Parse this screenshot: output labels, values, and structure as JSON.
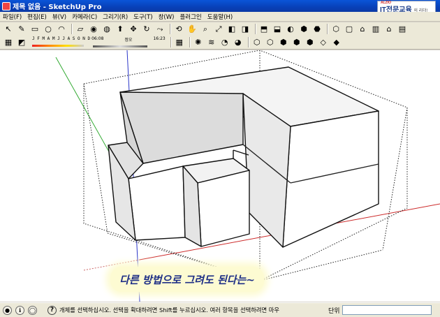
{
  "window": {
    "title": "제목 없음 - SketchUp Pro"
  },
  "brand": {
    "small": "ALZIO",
    "main": "IT전문교육",
    "tail": "의 리더!"
  },
  "menu": [
    "파일(F)",
    "편집(E)",
    "뷰(V)",
    "카메라(C)",
    "그리기(R)",
    "도구(T)",
    "창(W)",
    "플러그인",
    "도움말(H)"
  ],
  "toolbar1": [
    {
      "name": "select-icon",
      "glyph": "↖"
    },
    {
      "name": "pencil-icon",
      "glyph": "✎"
    },
    {
      "name": "rectangle-icon",
      "glyph": "▭"
    },
    {
      "name": "circle-icon",
      "glyph": "○"
    },
    {
      "name": "arc-icon",
      "glyph": "◠"
    },
    {
      "name": "eraser-icon",
      "glyph": "▱"
    },
    {
      "name": "tape-measure-icon",
      "glyph": "◉"
    },
    {
      "name": "paint-bucket-icon",
      "glyph": "◍"
    },
    {
      "name": "push-pull-icon",
      "glyph": "⬆"
    },
    {
      "name": "move-icon",
      "glyph": "✥"
    },
    {
      "name": "rotate-icon",
      "glyph": "↻"
    },
    {
      "name": "follow-me-icon",
      "glyph": "⤳"
    },
    {
      "name": "orbit-icon",
      "glyph": "⟲"
    },
    {
      "name": "pan-icon",
      "glyph": "✋"
    },
    {
      "name": "zoom-icon",
      "glyph": "⌕"
    },
    {
      "name": "zoom-extents-icon",
      "glyph": "⤢"
    },
    {
      "name": "previous-view-icon",
      "glyph": "◧"
    },
    {
      "name": "next-view-icon",
      "glyph": "◨"
    },
    {
      "name": "get-models-icon",
      "glyph": "⬒"
    },
    {
      "name": "share-model-icon",
      "glyph": "⬓"
    },
    {
      "name": "google-earth-icon",
      "glyph": "◐"
    },
    {
      "name": "components-icon",
      "glyph": "⬢"
    },
    {
      "name": "materials-icon",
      "glyph": "⬣"
    },
    {
      "name": "iso-view-icon",
      "glyph": "⬡"
    },
    {
      "name": "top-view-icon",
      "glyph": "▢"
    },
    {
      "name": "front-view-icon",
      "glyph": "⌂"
    },
    {
      "name": "right-view-icon",
      "glyph": "▥"
    },
    {
      "name": "back-view-icon",
      "glyph": "⌂"
    },
    {
      "name": "left-view-icon",
      "glyph": "▤"
    }
  ],
  "shadow": {
    "months": "J F M A M J J A S O N D",
    "time_start": "06:08",
    "noon": "정오",
    "time_end": "16:23"
  },
  "toolbar2_right": [
    {
      "name": "layer-icon",
      "glyph": "▦"
    },
    {
      "name": "bulb-icon",
      "glyph": "✺"
    },
    {
      "name": "fog-icon",
      "glyph": "≋"
    },
    {
      "name": "section-plane-icon",
      "glyph": "◔"
    },
    {
      "name": "section-cut-icon",
      "glyph": "◕"
    },
    {
      "name": "wireframe-icon",
      "glyph": "⬡"
    },
    {
      "name": "hidden-line-icon",
      "glyph": "⬡"
    },
    {
      "name": "shaded-icon",
      "glyph": "⬢"
    },
    {
      "name": "textured-icon",
      "glyph": "⬢"
    },
    {
      "name": "monochrome-icon",
      "glyph": "⬢"
    },
    {
      "name": "xray-icon",
      "glyph": "◇"
    },
    {
      "name": "back-edges-icon",
      "glyph": "◆"
    }
  ],
  "caption": "다른 방법으로 그려도 된다는~",
  "status": {
    "message": "개체를 선택하십시오. 선택을 확대하려면 Shift를 누르십시오. 여러 항목을 선택하려면 마우",
    "measure_label": "단위",
    "measure_value": ""
  },
  "colors": {
    "titlebar": "#0a55d8",
    "axis_red": "#cc2222",
    "axis_green": "#22aa22",
    "axis_blue": "#2233cc"
  }
}
